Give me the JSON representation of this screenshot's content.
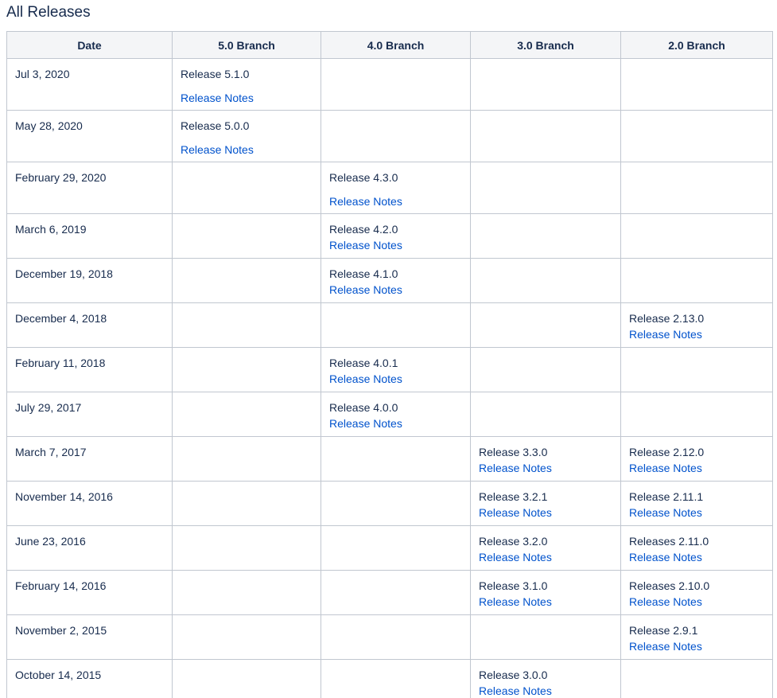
{
  "page": {
    "title": "All Releases"
  },
  "table": {
    "headers": [
      "Date",
      "5.0 Branch",
      "4.0 Branch",
      "3.0 Branch",
      "2.0 Branch"
    ],
    "link_label": "Release Notes",
    "rows": [
      {
        "date": "Jul 3, 2020",
        "b5": "Release 5.1.0",
        "b4": "",
        "b3": "",
        "b2": ""
      },
      {
        "date": "May 28, 2020",
        "b5": "Release 5.0.0",
        "b4": "",
        "b3": "",
        "b2": ""
      },
      {
        "date": "February 29, 2020",
        "b5": "",
        "b4": "Release 4.3.0",
        "b3": "",
        "b2": ""
      },
      {
        "date": "March 6, 2019",
        "b5": "",
        "b4": "Release 4.2.0",
        "b3": "",
        "b2": ""
      },
      {
        "date": "December 19, 2018",
        "b5": "",
        "b4": "Release 4.1.0",
        "b3": "",
        "b2": ""
      },
      {
        "date": "December 4, 2018",
        "b5": "",
        "b4": "",
        "b3": "",
        "b2": "Release 2.13.0"
      },
      {
        "date": "February 11, 2018",
        "b5": "",
        "b4": "Release 4.0.1",
        "b3": "",
        "b2": ""
      },
      {
        "date": "July 29, 2017",
        "b5": "",
        "b4": "Release 4.0.0",
        "b3": "",
        "b2": ""
      },
      {
        "date": "March 7, 2017",
        "b5": "",
        "b4": "",
        "b3": "Release 3.3.0",
        "b2": "Release 2.12.0"
      },
      {
        "date": "November 14, 2016",
        "b5": "",
        "b4": "",
        "b3": "Release 3.2.1",
        "b2": "Release 2.11.1"
      },
      {
        "date": "June 23, 2016",
        "b5": "",
        "b4": "",
        "b3": "Release 3.2.0",
        "b2": "Releases 2.11.0"
      },
      {
        "date": "February 14, 2016",
        "b5": "",
        "b4": "",
        "b3": "Release 3.1.0",
        "b2": "Releases 2.10.0"
      },
      {
        "date": "November 2, 2015",
        "b5": "",
        "b4": "",
        "b3": "",
        "b2": "Release 2.9.1"
      },
      {
        "date": "October 14, 2015",
        "b5": "",
        "b4": "",
        "b3": "Release 3.0.0",
        "b2": ""
      }
    ]
  },
  "colors": {
    "text": "#172b4d",
    "link": "#0052cc",
    "header_bg": "#f4f5f7",
    "border": "#c1c7d0"
  }
}
